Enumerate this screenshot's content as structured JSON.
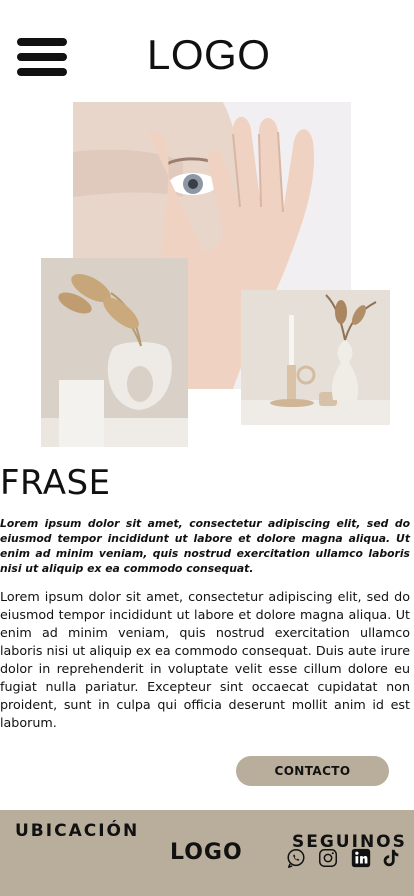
{
  "header": {
    "logo": "LOGO",
    "menu_icon": "hamburger-menu-icon"
  },
  "gallery": {
    "images": [
      {
        "name": "face-photo",
        "alt": ""
      },
      {
        "name": "vase-left-photo",
        "alt": ""
      },
      {
        "name": "vase-right-photo",
        "alt": ""
      }
    ]
  },
  "content": {
    "headline": "FRASE",
    "intro": "Lorem ipsum dolor sit amet, consectetur adipiscing elit, sed do eiusmod tempor incididunt ut labore et dolore magna aliqua. Ut enim ad minim veniam, quis nostrud exercitation ullamco laboris nisi ut aliquip ex ea commodo consequat.",
    "body": "Lorem ipsum dolor sit amet, consectetur adipiscing elit, sed do eiusmod tempor incididunt ut labore et dolore magna aliqua. Ut enim ad minim veniam, quis nostrud exercitation ullamco laboris nisi ut aliquip ex ea commodo consequat. Duis aute irure dolor in reprehenderit in voluptate velit esse cillum dolore eu fugiat nulla pariatur. Excepteur sint occaecat cupidatat non proident, sunt in culpa qui officia deserunt mollit anim id est laborum."
  },
  "cta": {
    "label": "CONTACTO"
  },
  "footer": {
    "location_label": "UBICACIÓN",
    "logo": "LOGO",
    "social_title": "SEGUINOS",
    "social_icons": [
      "whatsapp-icon",
      "instagram-icon",
      "linkedin-icon",
      "tiktok-icon"
    ]
  },
  "colors": {
    "accent": "#b9ad9b",
    "text": "#111111",
    "background": "#ffffff"
  }
}
